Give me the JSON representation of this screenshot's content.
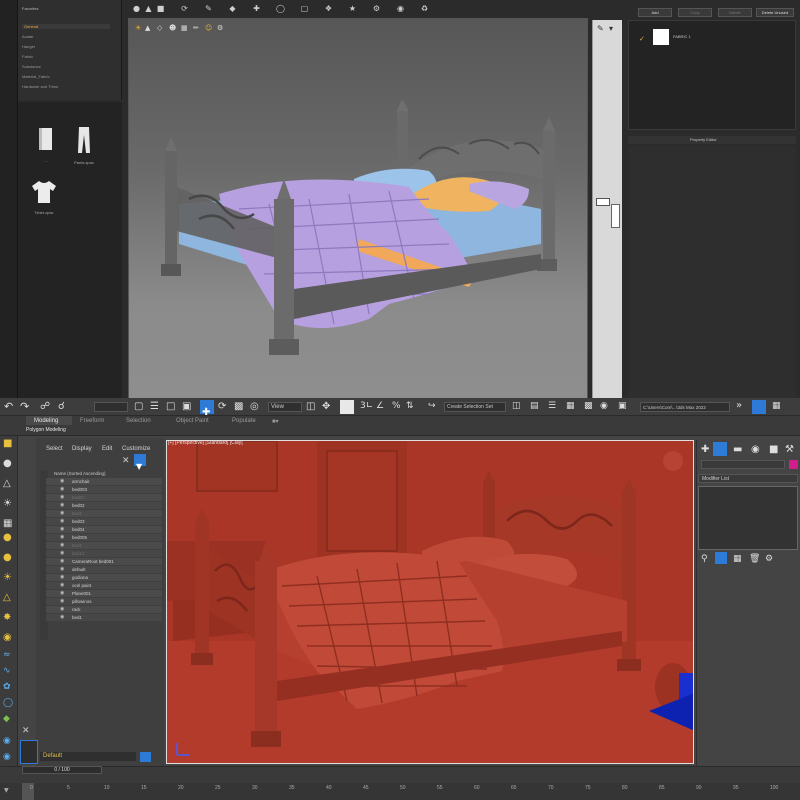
{
  "top_app": {
    "library_tree": [
      "General",
      "Avatar",
      "Hanger",
      "Fabric",
      "Substance",
      "Material_Fabric",
      "Hardware and Trims"
    ],
    "library_tree_title": "Favorites",
    "library_items": [
      {
        "label": "...",
        "icon": "book-icon"
      },
      {
        "label": "Pants.zpac",
        "icon": "pants-icon"
      },
      {
        "label": "Tshirt.zpac",
        "icon": "tshirt-icon"
      }
    ],
    "right_buttons": [
      "Add",
      "Copy",
      "Delete",
      "Delete Unused"
    ],
    "object_item": "FABRIC 1",
    "property_title": "Property Editor"
  },
  "bottom_app": {
    "main_toolbar": {
      "view_dropdown": "View",
      "selection_set": "Create Selection Set",
      "path_field": "C:\\Users\\Com\\...\\3ds Max 2022"
    },
    "ribbon_tabs": [
      "Modeling",
      "Freeform",
      "Selection",
      "Object Paint",
      "Populate"
    ],
    "ribbon_sub": "Polygon Modeling",
    "scene_explorer": {
      "menu": [
        "Select",
        "Display",
        "Edit",
        "Customize"
      ],
      "header": "Name (Sorted Ascending)",
      "rows": [
        {
          "name": "armchair",
          "hidden": false
        },
        {
          "name": "bed003",
          "hidden": false
        },
        {
          "name": "bed01",
          "hidden": true
        },
        {
          "name": "bed02",
          "hidden": false
        },
        {
          "name": "bed1",
          "hidden": true
        },
        {
          "name": "bed03",
          "hidden": false
        },
        {
          "name": "bed04",
          "hidden": false
        },
        {
          "name": "bed005",
          "hidden": false
        },
        {
          "name": "bed1",
          "hidden": true
        },
        {
          "name": "bed12",
          "hidden": true
        },
        {
          "name": "CameraRoot bed001",
          "hidden": false
        },
        {
          "name": "default",
          "hidden": false
        },
        {
          "name": "godiona",
          "hidden": false
        },
        {
          "name": "ocel paint",
          "hidden": false
        },
        {
          "name": "Plane001",
          "hidden": false
        },
        {
          "name": "pillowinos",
          "hidden": false
        },
        {
          "name": "rack",
          "hidden": false
        },
        {
          "name": "bed1",
          "hidden": false
        }
      ]
    },
    "viewport_label": "[+] [Perspective] [Standard] [Clay]",
    "modifier_list": "Modifier List",
    "layer": "Default",
    "frame_counter": "0 / 100",
    "timeline_ticks": [
      "0",
      "5",
      "10",
      "15",
      "20",
      "25",
      "30",
      "35",
      "40",
      "45",
      "50",
      "55",
      "60",
      "65",
      "70",
      "75",
      "80",
      "85",
      "90",
      "95",
      "100"
    ]
  },
  "colors": {
    "clay_red": "#b33a2a",
    "accent_blue": "#2d7bd6",
    "layer_yellow": "#e0c050"
  }
}
